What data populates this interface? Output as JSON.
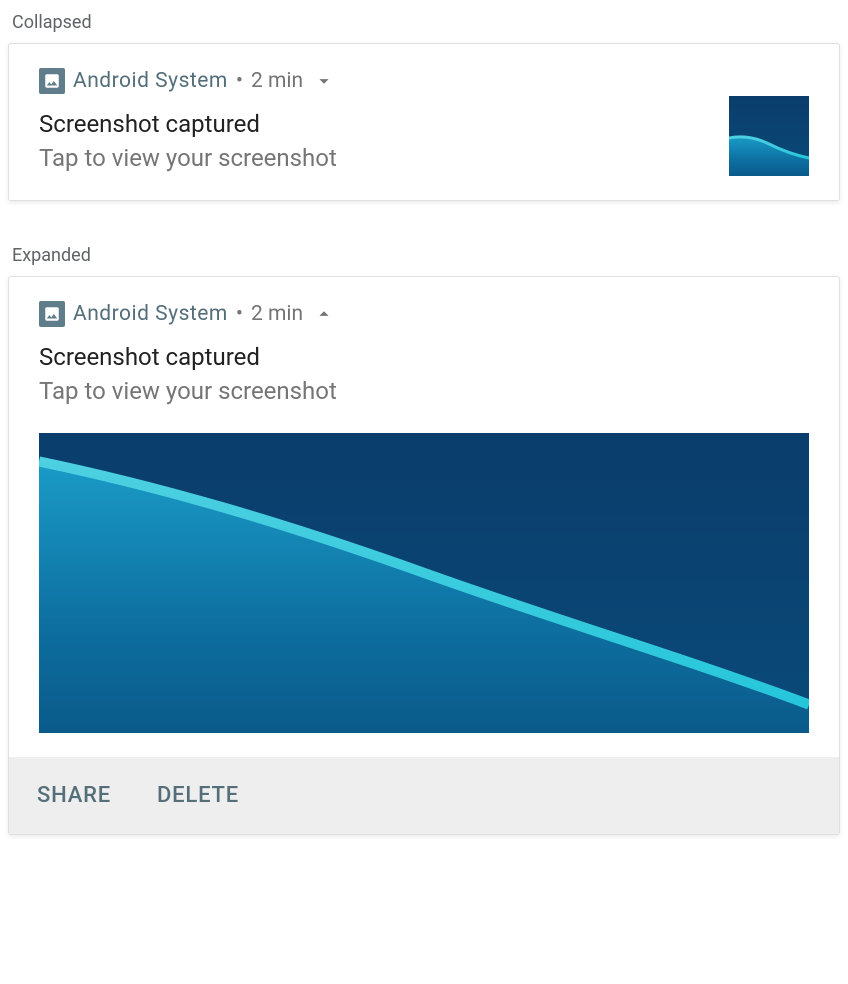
{
  "sections": {
    "collapsed_label": "Collapsed",
    "expanded_label": "Expanded"
  },
  "notification": {
    "app_name": "Android  System",
    "timestamp": "2 min",
    "title": "Screenshot captured",
    "subtitle": "Tap to view your screenshot"
  },
  "actions": {
    "share": "SHARE",
    "delete": "DELETE"
  }
}
